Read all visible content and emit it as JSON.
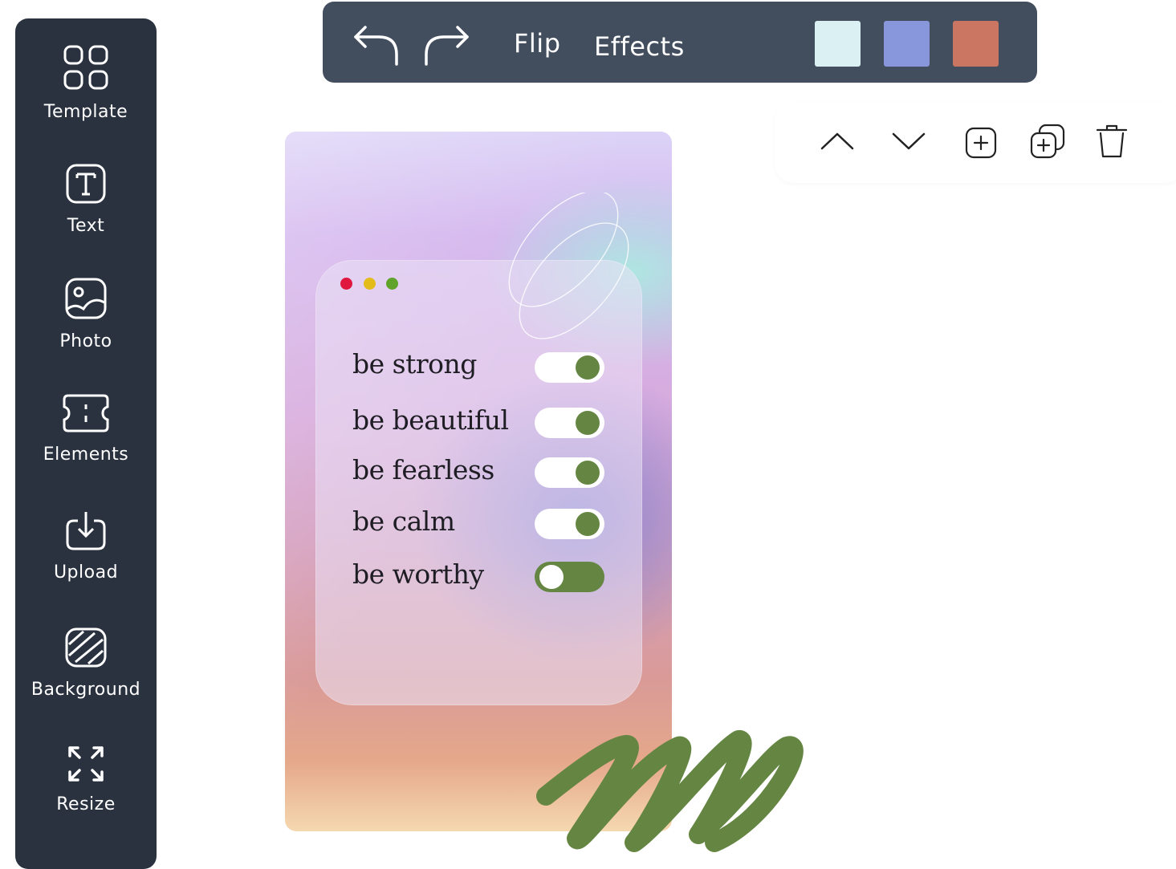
{
  "sidebar": {
    "items": [
      {
        "label": "Template",
        "icon": "grid-icon"
      },
      {
        "label": "Text",
        "icon": "text-icon"
      },
      {
        "label": "Photo",
        "icon": "image-icon"
      },
      {
        "label": "Elements",
        "icon": "elements-icon"
      },
      {
        "label": "Upload",
        "icon": "upload-icon"
      },
      {
        "label": "Background",
        "icon": "background-icon"
      },
      {
        "label": "Resize",
        "icon": "resize-icon"
      }
    ]
  },
  "toolbar": {
    "undo_icon": "undo-icon",
    "redo_icon": "redo-icon",
    "flip_label": "Flip",
    "effects_label": "Effects",
    "swatches": [
      "#dbf0f2",
      "#8896db",
      "#cb7663"
    ]
  },
  "arrange": {
    "icons": [
      "move-up-icon",
      "move-down-icon",
      "add-icon",
      "duplicate-icon",
      "delete-icon"
    ]
  },
  "card": {
    "window_dots": [
      "#e0183f",
      "#e3bb1a",
      "#5fa32a"
    ],
    "affirmations": [
      {
        "text": "be strong",
        "toggle": "on"
      },
      {
        "text": "be beautiful",
        "toggle": "on"
      },
      {
        "text": "be fearless",
        "toggle": "on"
      },
      {
        "text": "be calm",
        "toggle": "on"
      },
      {
        "text": "be worthy",
        "toggle": "off"
      }
    ],
    "toggle_color": "#648642"
  },
  "decor": {
    "scribble_color": "#648642"
  }
}
